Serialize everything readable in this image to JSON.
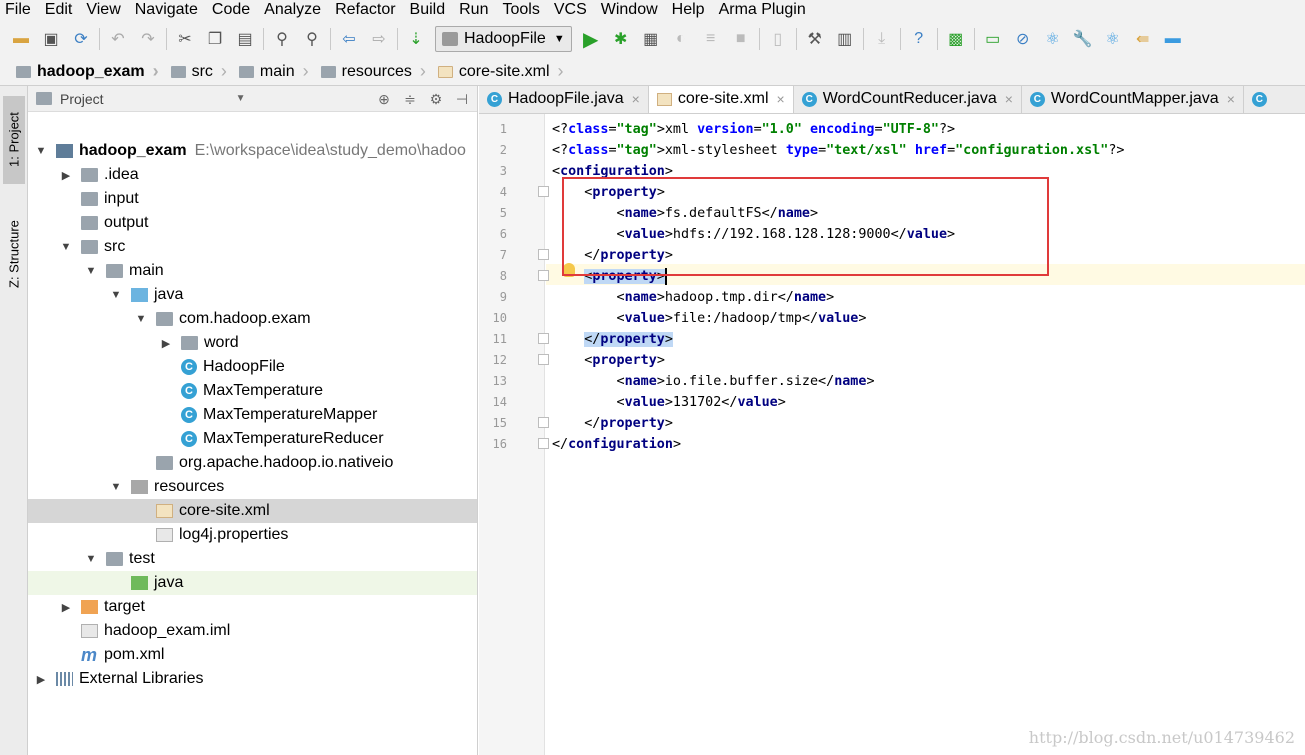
{
  "menu": [
    "File",
    "Edit",
    "View",
    "Navigate",
    "Code",
    "Analyze",
    "Refactor",
    "Build",
    "Run",
    "Tools",
    "VCS",
    "Window",
    "Help",
    "Arma Plugin"
  ],
  "toolbar": {
    "run_config": "HadoopFile",
    "colors": {
      "run": "#2aa12a",
      "accent": "#1e74d8"
    }
  },
  "breadcrumb": [
    "hadoop_exam",
    "src",
    "main",
    "resources",
    "core-site.xml"
  ],
  "left_strip": {
    "project_tab": "1: Project",
    "structure_tab": "Z: Structure"
  },
  "project_panel": {
    "title": "Project",
    "tree": [
      {
        "label": "hadoop_exam",
        "path": "E:\\workspace\\idea\\study_demo\\hadoo",
        "bold": true,
        "icon": "module-icon"
      },
      {
        "label": ".idea",
        "icon": "folder-icon"
      },
      {
        "label": "input",
        "icon": "folder-icon"
      },
      {
        "label": "output",
        "icon": "folder-icon"
      },
      {
        "label": "src",
        "icon": "folder-icon"
      },
      {
        "label": "main",
        "icon": "folder-icon"
      },
      {
        "label": "java",
        "icon": "source-folder-icon"
      },
      {
        "label": "com.hadoop.exam",
        "icon": "package-icon"
      },
      {
        "label": "word",
        "icon": "package-icon"
      },
      {
        "label": "HadoopFile",
        "icon": "class-icon"
      },
      {
        "label": "MaxTemperature",
        "icon": "class-icon"
      },
      {
        "label": "MaxTemperatureMapper",
        "icon": "class-icon"
      },
      {
        "label": "MaxTemperatureReducer",
        "icon": "class-icon"
      },
      {
        "label": "org.apache.hadoop.io.nativeio",
        "icon": "package-icon"
      },
      {
        "label": "resources",
        "icon": "resources-folder-icon"
      },
      {
        "label": "core-site.xml",
        "icon": "xml-file-icon"
      },
      {
        "label": "log4j.properties",
        "icon": "properties-file-icon"
      },
      {
        "label": "test",
        "icon": "folder-icon"
      },
      {
        "label": "java",
        "icon": "test-source-folder-icon"
      },
      {
        "label": "target",
        "icon": "target-folder-icon"
      },
      {
        "label": "hadoop_exam.iml",
        "icon": "iml-file-icon"
      },
      {
        "label": "pom.xml",
        "icon": "maven-icon"
      },
      {
        "label": "External Libraries",
        "icon": "libraries-icon"
      }
    ]
  },
  "editor": {
    "tabs": [
      "HadoopFile.java",
      "core-site.xml",
      "WordCountReducer.java",
      "WordCountMapper.java"
    ],
    "active_tab": "core-site.xml",
    "line_numbers": [
      "1",
      "2",
      "3",
      "4",
      "5",
      "6",
      "7",
      "8",
      "9",
      "10",
      "11",
      "12",
      "13",
      "14",
      "15",
      "16"
    ],
    "lines": [
      {
        "ind": "",
        "t": "<?xml version=\"1.0\" encoding=\"UTF-8\"?>"
      },
      {
        "ind": "",
        "t": "<?xml-stylesheet type=\"text/xsl\" href=\"configuration.xsl\"?>"
      },
      {
        "ind": "",
        "t": "<configuration>"
      },
      {
        "ind": "    ",
        "t": "<property>"
      },
      {
        "ind": "        ",
        "t": "<name>fs.defaultFS</name>"
      },
      {
        "ind": "        ",
        "t": "<value>hdfs://192.168.128.128:9000</value>"
      },
      {
        "ind": "    ",
        "t": "</property>"
      },
      {
        "ind": "    ",
        "t": "<property>"
      },
      {
        "ind": "        ",
        "t": "<name>hadoop.tmp.dir</name>"
      },
      {
        "ind": "        ",
        "t": "<value>file:/hadoop/tmp</value>"
      },
      {
        "ind": "    ",
        "t": "</property>"
      },
      {
        "ind": "    ",
        "t": "<property>"
      },
      {
        "ind": "        ",
        "t": "<name>io.file.buffer.size</name>"
      },
      {
        "ind": "        ",
        "t": "<value>131702</value>"
      },
      {
        "ind": "    ",
        "t": "</property>"
      },
      {
        "ind": "",
        "t": "</configuration>"
      }
    ],
    "highlight_color": "#e03a3a"
  },
  "watermark": "http://blog.csdn.net/u014739462"
}
